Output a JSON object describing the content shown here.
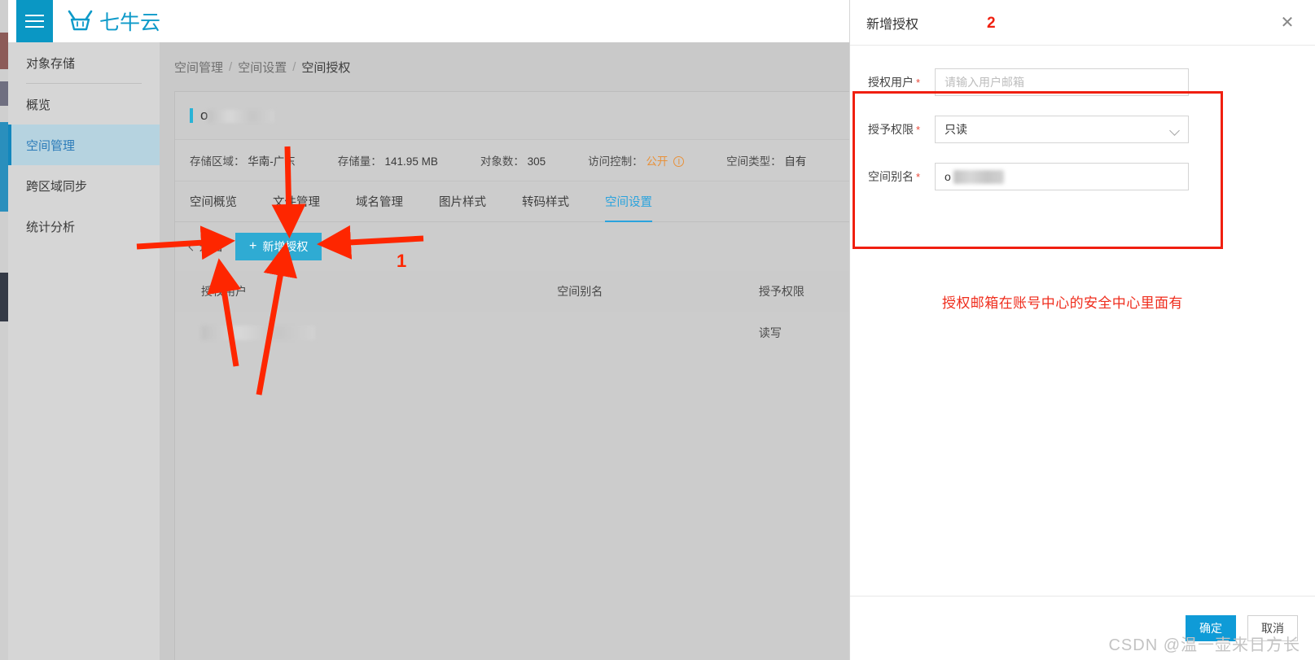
{
  "topbar": {
    "menu_icon": "hamburger-icon",
    "brand_logo_icon": "qiniu-bull-logo-icon",
    "brand_text": "七牛云"
  },
  "sidebar": {
    "title": "对象存储",
    "items": [
      {
        "label": "概览",
        "active": false
      },
      {
        "label": "空间管理",
        "active": true
      },
      {
        "label": "跨区域同步",
        "active": false
      },
      {
        "label": "统计分析",
        "active": false
      }
    ]
  },
  "breadcrumb": {
    "items": [
      "空间管理",
      "空间设置",
      "空间授权"
    ],
    "separator": "/"
  },
  "bucket": {
    "name_prefix": "o",
    "name_redacted": true
  },
  "meta": [
    {
      "key": "存储区域：",
      "value": "华南-广东",
      "warn": false
    },
    {
      "key": "存储量：",
      "value": "141.95 MB",
      "warn": false
    },
    {
      "key": "对象数：",
      "value": "305",
      "warn": false
    },
    {
      "key": "访问控制：",
      "value": "公开",
      "warn": true,
      "icon": "info-circle-icon"
    },
    {
      "key": "空间类型：",
      "value": "自有",
      "warn": false
    }
  ],
  "tabs": [
    {
      "label": "空间概览",
      "active": false
    },
    {
      "label": "文件管理",
      "active": false
    },
    {
      "label": "域名管理",
      "active": false
    },
    {
      "label": "图片样式",
      "active": false
    },
    {
      "label": "转码样式",
      "active": false
    },
    {
      "label": "空间设置",
      "active": true
    }
  ],
  "toolbar": {
    "back_label": "返回",
    "back_icon": "chevron-left-icon",
    "add_label": "新增授权",
    "add_icon": "plus-icon"
  },
  "table": {
    "columns": [
      "授权用户",
      "空间别名",
      "授予权限"
    ],
    "rows": [
      {
        "user": "",
        "user_redacted": true,
        "alias": "",
        "perm": "读写"
      }
    ]
  },
  "modal": {
    "title": "新增授权",
    "close_icon": "close-icon",
    "fields": [
      {
        "label": "授权用户",
        "required_marker": "*",
        "type": "text",
        "value": "",
        "placeholder": "请输入用户邮箱"
      },
      {
        "label": "授予权限",
        "required_marker": "*",
        "type": "select",
        "value": "只读",
        "placeholder": "",
        "chevron_icon": "chevron-down-icon"
      },
      {
        "label": "空间别名",
        "required_marker": "*",
        "type": "text",
        "value": "o",
        "value_redacted": true,
        "placeholder": ""
      }
    ],
    "note": "授权邮箱在账号中心的安全中心里面有",
    "confirm_label": "确定",
    "cancel_label": "取消"
  },
  "annotations": {
    "marker_1": "1",
    "marker_2": "2",
    "highlight_color": "#f01f10",
    "arrow_color": "#fe2600"
  },
  "watermark": "CSDN @温一壶来日方长",
  "colors": {
    "brand": "#0e9ac9",
    "accent": "#2fabd3",
    "sidebar_active_bg": "#b6d3e0",
    "sidebar_active_text": "#2b7bb9",
    "warn": "#e8913a",
    "annotation_red": "#f02010",
    "confirm_button": "#0f9bd7"
  }
}
